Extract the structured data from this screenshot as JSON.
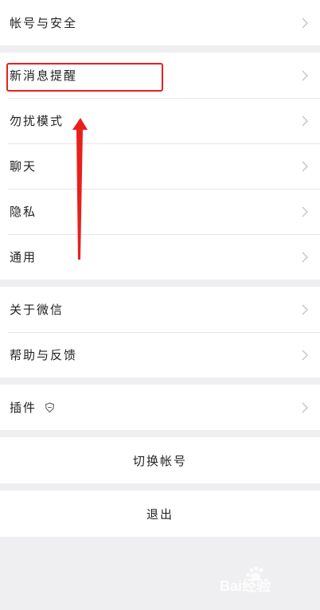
{
  "group1": {
    "items": [
      {
        "label": "帐号与安全"
      }
    ]
  },
  "group2": {
    "items": [
      {
        "label": "新消息提醒"
      },
      {
        "label": "勿扰模式"
      },
      {
        "label": "聊天"
      },
      {
        "label": "隐私"
      },
      {
        "label": "通用"
      }
    ]
  },
  "group3": {
    "items": [
      {
        "label": "关于微信"
      },
      {
        "label": "帮助与反馈"
      }
    ]
  },
  "group4": {
    "items": [
      {
        "label": "插件",
        "icon": "shield-icon"
      }
    ]
  },
  "switch_account": {
    "label": "切换帐号"
  },
  "logout": {
    "label": "退出"
  },
  "colors": {
    "highlight": "#e8201c",
    "background": "#efeff1",
    "chevron": "#c7c7cc"
  },
  "watermark": {
    "text": "Bai经验"
  }
}
